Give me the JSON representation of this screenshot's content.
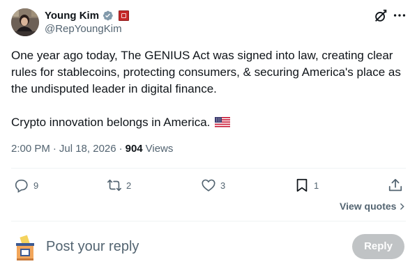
{
  "author": {
    "display_name": "Young Kim",
    "handle": "@RepYoungKim",
    "verified_icon": "verified-badge-icon",
    "affiliation_icon": "government-badge-icon"
  },
  "header_icons": [
    "grok-icon",
    "more-icon"
  ],
  "tweet": {
    "paragraph_1": "One year ago today, The GENIUS Act was signed into law, creating clear rules for stablecoins, protecting consumers, & securing America's place as the undisputed leader in digital finance.",
    "paragraph_2": "Crypto innovation belongs in America.",
    "emoji": "us-flag"
  },
  "meta": {
    "time": "2:00 PM",
    "separator": "·",
    "date": "Jul 18, 2026",
    "views_count": "904",
    "views_label": "Views"
  },
  "actions": {
    "replies": "9",
    "reposts": "2",
    "likes": "3",
    "bookmarks": "1"
  },
  "view_quotes_label": "View quotes",
  "composer": {
    "placeholder": "Post your reply",
    "reply_label": "Reply"
  },
  "colors": {
    "text_primary": "#0f1419",
    "text_secondary": "#536471",
    "verified_blue": "#829aab",
    "divider": "#eff3f4",
    "reply_button": "#8e9396"
  }
}
